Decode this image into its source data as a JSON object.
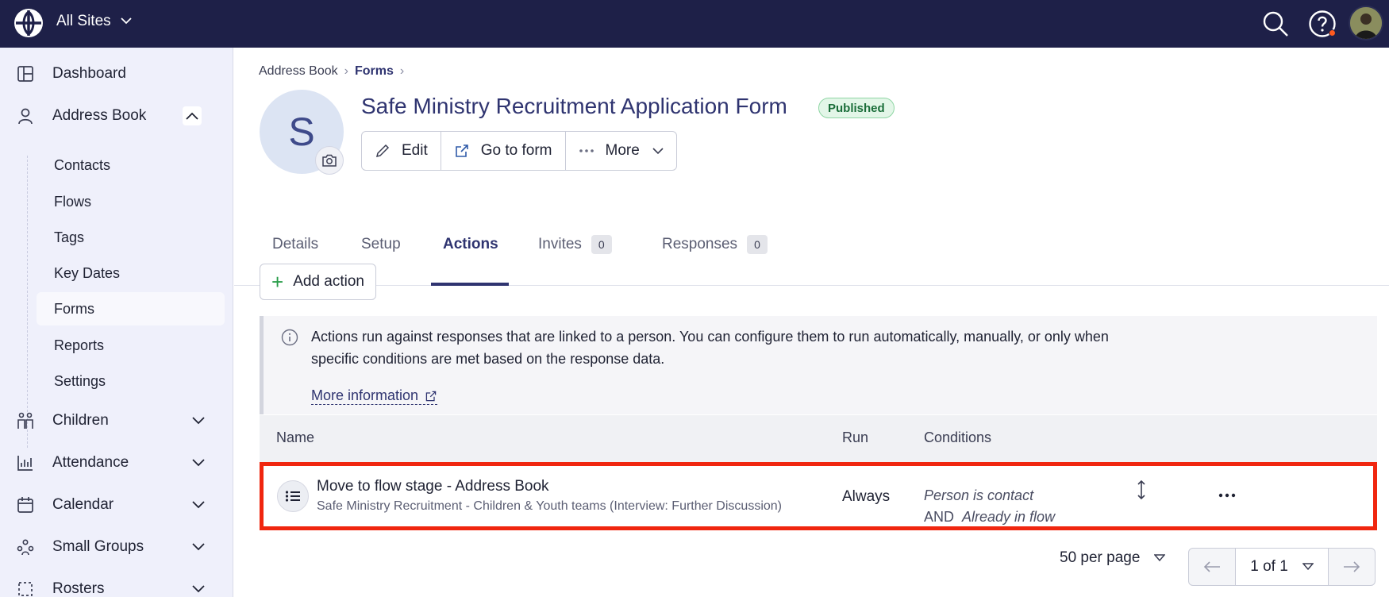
{
  "topbar": {
    "site_label": "All Sites",
    "icons": [
      "globe-logo-icon",
      "search-icon",
      "help-icon",
      "user-avatar"
    ]
  },
  "sidebar": {
    "items": [
      {
        "label": "Dashboard",
        "icon": "dashboard-icon"
      },
      {
        "label": "Address Book",
        "icon": "person-icon"
      },
      {
        "label": "Children",
        "icon": "children-icon"
      },
      {
        "label": "Attendance",
        "icon": "chart-icon"
      },
      {
        "label": "Calendar",
        "icon": "calendar-icon"
      },
      {
        "label": "Small Groups",
        "icon": "groups-icon"
      },
      {
        "label": "Rosters",
        "icon": "rosters-icon"
      }
    ],
    "subitems": [
      "Contacts",
      "Flows",
      "Tags",
      "Key Dates",
      "Forms",
      "Reports",
      "Settings"
    ],
    "active_subitem": "Forms"
  },
  "breadcrumb": {
    "root": "Address Book",
    "current": "Forms"
  },
  "page": {
    "avatar_letter": "S",
    "title": "Safe Ministry Recruitment Application Form",
    "status": "Published",
    "buttons": {
      "edit": "Edit",
      "goto": "Go to form",
      "more": "More"
    }
  },
  "tabs": [
    {
      "label": "Details"
    },
    {
      "label": "Setup"
    },
    {
      "label": "Actions",
      "active": true
    },
    {
      "label": "Invites",
      "count": "0"
    },
    {
      "label": "Responses",
      "count": "0"
    }
  ],
  "add_action_label": "Add action",
  "info": {
    "text": "Actions run against responses that are linked to a person. You can configure them to run automatically, manually, or only when specific conditions are met based on the response data.",
    "link": "More information"
  },
  "table": {
    "headers": {
      "name": "Name",
      "run": "Run",
      "conditions": "Conditions"
    },
    "rows": [
      {
        "title": "Move to flow stage - Address Book",
        "subtitle": "Safe Ministry Recruitment - Children & Youth teams (Interview: Further Discussion)",
        "run": "Always",
        "condition_1": "Person is contact",
        "condition_op": "AND",
        "condition_2": "Already in flow"
      }
    ]
  },
  "pagination": {
    "per_page": "50 per page",
    "page": "1 of 1"
  },
  "colors": {
    "topbar": "#1e2048",
    "sidebar": "#eff0fb",
    "accent": "#2f3470",
    "highlight": "#f0260f",
    "published": "#1b6e3a"
  }
}
